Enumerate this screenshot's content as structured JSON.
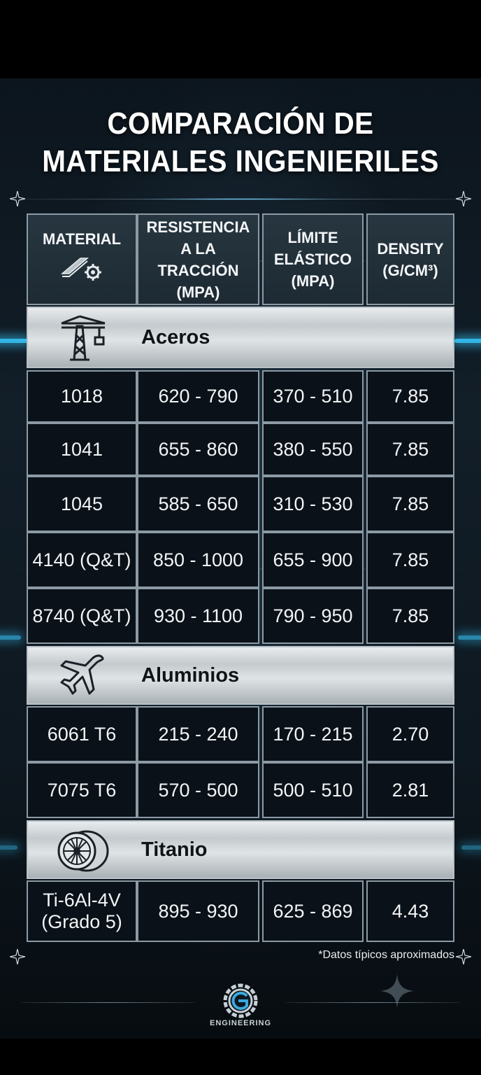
{
  "title_line1": "COMPARACIÓN DE",
  "title_line2": "MATERIALES INGENIERILES",
  "headers": {
    "material": "MATERIAL",
    "tensile_l1": "RESISTENCIA",
    "tensile_l2": "A LA TRACCIÓN",
    "tensile_l3": "(MPA)",
    "yield_l1": "LÍMITE",
    "yield_l2": "ELÁSTICO",
    "yield_l3": "(MPA)",
    "density_l1": "DENSITY",
    "density_l2": "(G/CM³)"
  },
  "sections": {
    "steel": {
      "label": "Aceros",
      "icon": "crane-icon"
    },
    "aluminum": {
      "label": "Aluminios",
      "icon": "airplane-icon"
    },
    "titanium": {
      "label": "Titanio",
      "icon": "jet-engine-icon"
    }
  },
  "steel_rows": [
    {
      "material": "1018",
      "tensile": "620 - 790",
      "yield": "370 - 510",
      "density": "7.85"
    },
    {
      "material": "1041",
      "tensile": "655 - 860",
      "yield": "380 - 550",
      "density": "7.85"
    },
    {
      "material": "1045",
      "tensile": "585 - 650",
      "yield": "310 - 530",
      "density": "7.85"
    },
    {
      "material": "4140 (Q&T)",
      "tensile": "850 - 1000",
      "yield": "655 - 900",
      "density": "7.85"
    },
    {
      "material": "8740 (Q&T)",
      "tensile": "930 - 1100",
      "yield": "790 - 950",
      "density": "7.85"
    }
  ],
  "aluminum_rows": [
    {
      "material": "6061 T6",
      "tensile": "215 - 240",
      "yield": "170 - 215",
      "density": "2.70"
    },
    {
      "material": "7075 T6",
      "tensile": "570 - 500",
      "yield": "500 - 510",
      "density": "2.81"
    }
  ],
  "titanium_rows": [
    {
      "material_l1": "Ti-6Al-4V",
      "material_l2": "(Grado 5)",
      "tensile": "895 - 930",
      "yield": "625 - 869",
      "density": "4.43"
    }
  ],
  "footnote": "*Datos típicos aproximados",
  "logo_text": "ENGINEERING",
  "accent_color": "#33b5e5"
}
